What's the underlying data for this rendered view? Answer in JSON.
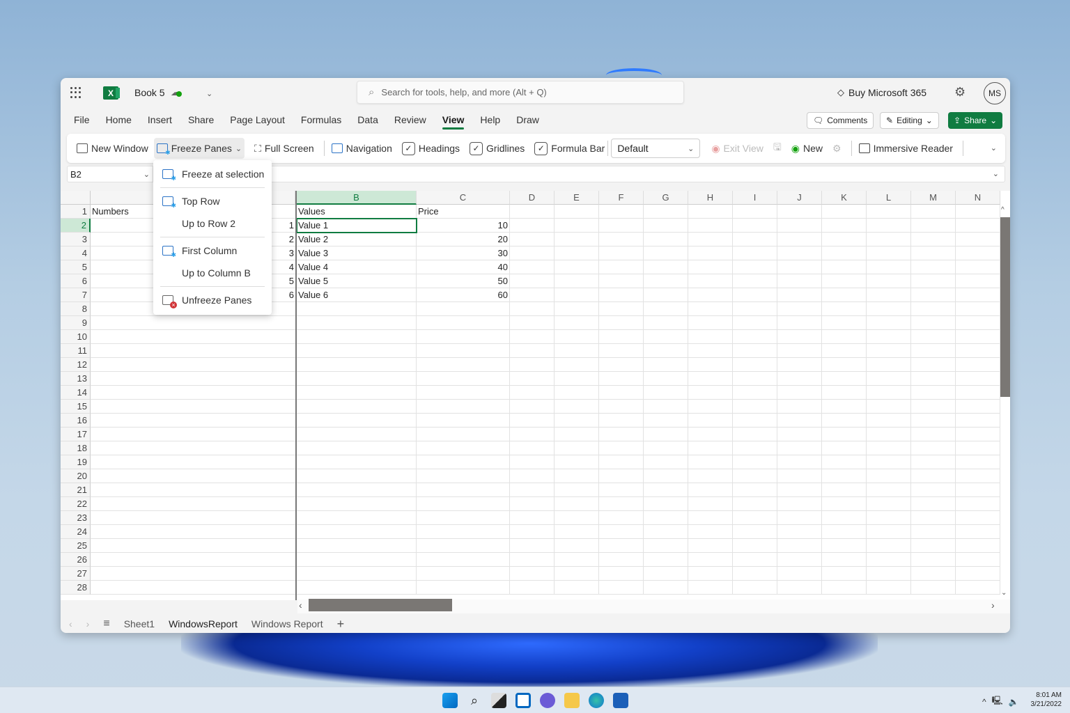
{
  "titlebar": {
    "app_name": "Excel",
    "book_title": "Book 5",
    "search_placeholder": "Search for tools, help, and more (Alt + Q)",
    "buy_label": "Buy Microsoft 365",
    "avatar_initials": "MS"
  },
  "menu": {
    "items": [
      "File",
      "Home",
      "Insert",
      "Share",
      "Page Layout",
      "Formulas",
      "Data",
      "Review",
      "View",
      "Help",
      "Draw"
    ],
    "active": "View"
  },
  "actions": {
    "comments": "Comments",
    "editing": "Editing",
    "share": "Share"
  },
  "ribbon": {
    "new_window": "New Window",
    "freeze_panes": "Freeze Panes",
    "full_screen": "Full Screen",
    "navigation": "Navigation",
    "headings": "Headings",
    "gridlines": "Gridlines",
    "formula_bar": "Formula Bar",
    "view_select": "Default",
    "exit_view": "Exit View",
    "new_view": "New",
    "immersive_reader": "Immersive Reader",
    "headings_checked": true,
    "gridlines_checked": true,
    "formula_bar_checked": true
  },
  "formula_bar": {
    "name_box": "B2",
    "formula": ""
  },
  "freeze_menu": {
    "items": [
      {
        "label": "Freeze at selection",
        "icon": "freeze-selection-icon"
      },
      {
        "label": "Top Row",
        "icon": "freeze-top-row-icon"
      },
      {
        "label": "Up to Row 2",
        "icon": ""
      },
      {
        "label": "First Column",
        "icon": "freeze-first-column-icon"
      },
      {
        "label": "Up to Column B",
        "icon": ""
      },
      {
        "label": "Unfreeze Panes",
        "icon": "unfreeze-icon"
      }
    ]
  },
  "grid": {
    "columns": [
      "B",
      "C",
      "D",
      "E",
      "F",
      "G",
      "H",
      "I",
      "J",
      "K",
      "L",
      "M",
      "N"
    ],
    "selected_cell": "B2",
    "rows": [
      "1",
      "2",
      "3",
      "4",
      "5",
      "6",
      "7",
      "8",
      "9",
      "10",
      "11",
      "12",
      "13",
      "14",
      "15",
      "16",
      "17",
      "18",
      "19",
      "20",
      "21",
      "22",
      "23",
      "24",
      "25",
      "26",
      "27",
      "28"
    ],
    "cells": {
      "A1": "Numbers",
      "A2": "1",
      "A3": "2",
      "A4": "3",
      "A5": "4",
      "A6": "5",
      "A7": "6",
      "B1": "Values",
      "B2": "Value 1",
      "B3": "Value 2",
      "B4": "Value 3",
      "B5": "Value 4",
      "B6": "Value 5",
      "B7": "Value 6",
      "C1": "Price",
      "C2": "10",
      "C3": "20",
      "C4": "30",
      "C5": "40",
      "C6": "50",
      "C7": "60"
    }
  },
  "sheets": {
    "tabs": [
      "Sheet1",
      "WindowsReport",
      "Windows Report"
    ],
    "active": "WindowsReport"
  },
  "taskbar": {
    "time": "8:01 AM",
    "date": "3/21/2022"
  }
}
